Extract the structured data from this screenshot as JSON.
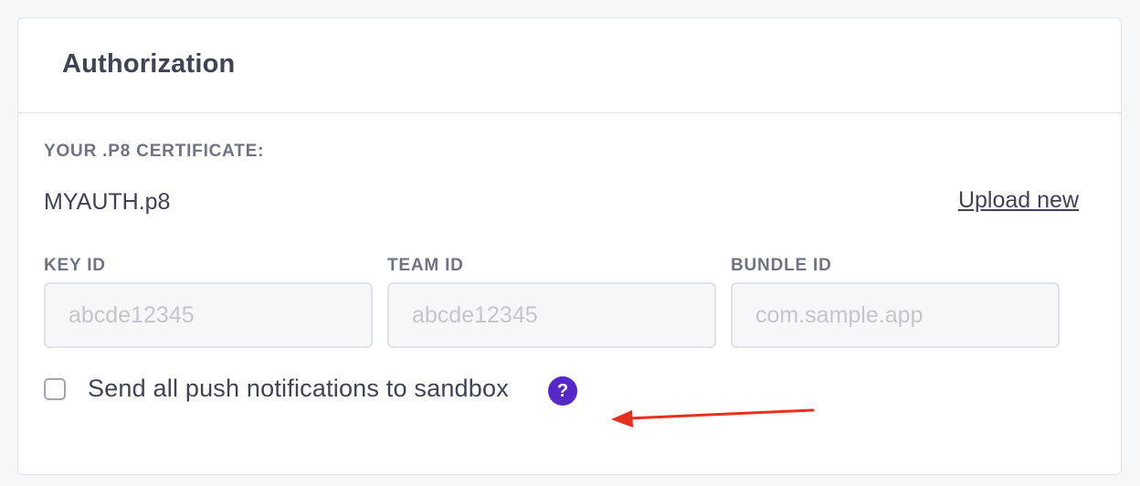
{
  "card": {
    "title": "Authorization"
  },
  "certificate": {
    "label": "YOUR .P8 CERTIFICATE:",
    "file_name": "MYAUTH.p8",
    "upload_link": "Upload new"
  },
  "fields": {
    "key_id": {
      "label": "KEY ID",
      "placeholder": "abcde12345",
      "value": ""
    },
    "team_id": {
      "label": "TEAM ID",
      "placeholder": "abcde12345",
      "value": ""
    },
    "bundle_id": {
      "label": "BUNDLE ID",
      "placeholder": "com.sample.app",
      "value": ""
    }
  },
  "sandbox": {
    "label": "Send all push notifications to sandbox",
    "checked": false,
    "help_icon": "question-mark-circle-icon",
    "help_glyph": "?"
  },
  "annotation": {
    "arrow_color": "#e8301f",
    "icon_name": "arrow-left-icon"
  },
  "colors": {
    "accent": "#5629c6",
    "text": "#3f4354",
    "label": "#6f7383"
  }
}
